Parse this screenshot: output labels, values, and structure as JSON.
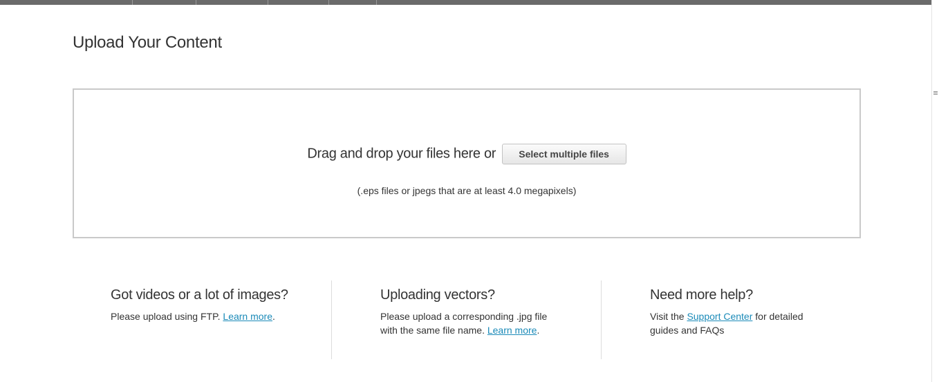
{
  "page": {
    "title": "Upload Your Content"
  },
  "dropzone": {
    "drag_text": "Drag and drop your files here or",
    "select_button_label": "Select multiple files",
    "note": "(.eps files or jpegs that are at least 4.0 megapixels)"
  },
  "help": {
    "ftp": {
      "heading": "Got videos or a lot of images?",
      "body_before": "Please upload using FTP. ",
      "link": "Learn more",
      "body_after": "."
    },
    "vectors": {
      "heading": "Uploading vectors?",
      "body_line1": "Please upload a corresponding .jpg file",
      "body_line2_before": "with the same file name. ",
      "link": "Learn more",
      "body_after": "."
    },
    "support": {
      "heading": "Need more help?",
      "body_before": "Visit the ",
      "link": "Support Center",
      "body_after": " for detailed",
      "body_line2": "guides and FAQs"
    }
  },
  "colors": {
    "link": "#1a8ab8",
    "top_nav": "#6b6b6b",
    "dropzone_border": "#c9c9c9"
  },
  "icons": {
    "scrollbar_grip": "scroll-grip-icon"
  }
}
